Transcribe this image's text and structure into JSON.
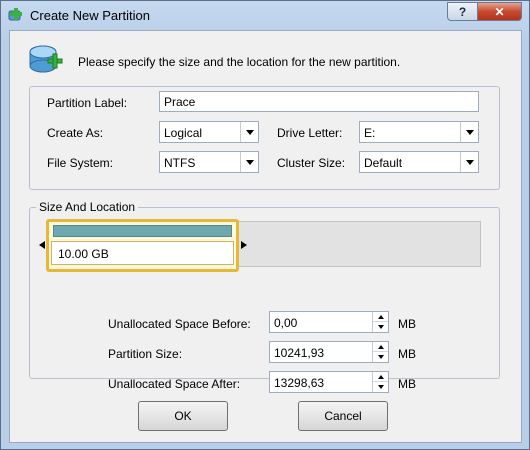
{
  "window": {
    "title": "Create New Partition",
    "help_label": "?",
    "close_label": "✕"
  },
  "header": {
    "instruction": "Please specify the size and the location for the new partition.",
    "icon": "disk-add-icon"
  },
  "fields": {
    "partition_label": {
      "label": "Partition Label:",
      "value": "Prace"
    },
    "create_as": {
      "label": "Create As:",
      "value": "Logical"
    },
    "drive_letter": {
      "label": "Drive Letter:",
      "value": "E:"
    },
    "file_system": {
      "label": "File System:",
      "value": "NTFS"
    },
    "cluster_size": {
      "label": "Cluster Size:",
      "value": "Default"
    }
  },
  "size_location": {
    "title": "Size And Location",
    "partition_size_display": "10.00 GB",
    "unallocated_before": {
      "label": "Unallocated Space Before:",
      "value": "0,00",
      "unit": "MB"
    },
    "partition_size": {
      "label": "Partition Size:",
      "value": "10241,93",
      "unit": "MB"
    },
    "unallocated_after": {
      "label": "Unallocated Space After:",
      "value": "13298,63",
      "unit": "MB"
    }
  },
  "buttons": {
    "ok": "OK",
    "cancel": "Cancel"
  },
  "colors": {
    "partition_fill": "#6fa9b0",
    "partition_border": "#e5b839",
    "close_button": "#c64a2f"
  }
}
